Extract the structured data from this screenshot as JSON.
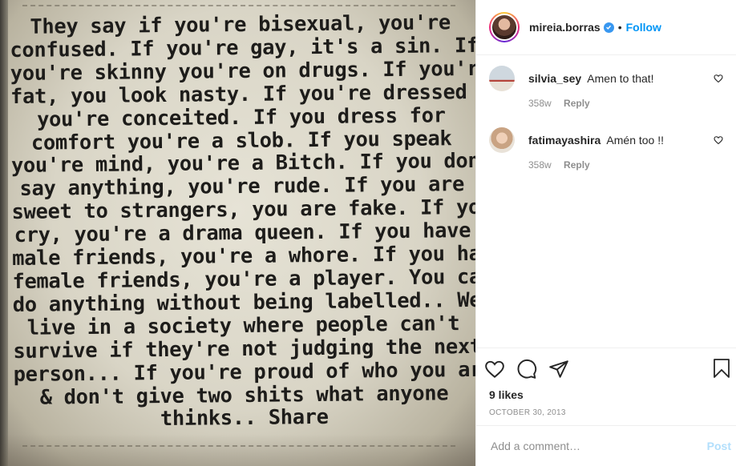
{
  "photo": {
    "quote_lines": [
      "They say if you're bisexual, you're",
      "confused. If you're gay, it's a sin. If",
      "you're skinny you're on drugs. If you're",
      "fat, you look nasty. If you're dressed up,",
      "you're conceited. If you dress for",
      "comfort you're a slob. If you speak",
      "you're mind, you're a Bitch. If you don't",
      "say anything, you're rude. If you are",
      "sweet to strangers, you are fake. If you",
      "cry, you're a drama queen. If you have",
      "male friends, you're a whore. If you have",
      "female friends, you're a player. You can't",
      "do anything without being labelled.. We",
      "live in a society where people can't",
      "survive if they're not judging the next",
      "person... If you're proud of who you are",
      "& don't give two shits what anyone",
      "thinks..  Share"
    ]
  },
  "header": {
    "username": "mireia.borras",
    "verified_icon": "verified-badge-icon",
    "separator": "•",
    "follow_label": "Follow"
  },
  "comments": [
    {
      "user": "silvia_sey",
      "text": "Amen to that!",
      "age": "358w",
      "reply_label": "Reply"
    },
    {
      "user": "fatimayashira",
      "text": "Amén too !!",
      "age": "358w",
      "reply_label": "Reply"
    }
  ],
  "actions": {
    "icons": [
      "heart-icon",
      "comment-icon",
      "share-icon",
      "bookmark-icon"
    ]
  },
  "likes": "9 likes",
  "date": "OCTOBER 30, 2013",
  "add_comment": {
    "placeholder": "Add a comment…",
    "post_label": "Post"
  },
  "colors": {
    "link_blue": "#0095f6",
    "verified_blue": "#3897f0",
    "post_disabled": "#b2dffc",
    "muted_gray": "#8e8e8e",
    "divider": "#efefef"
  }
}
